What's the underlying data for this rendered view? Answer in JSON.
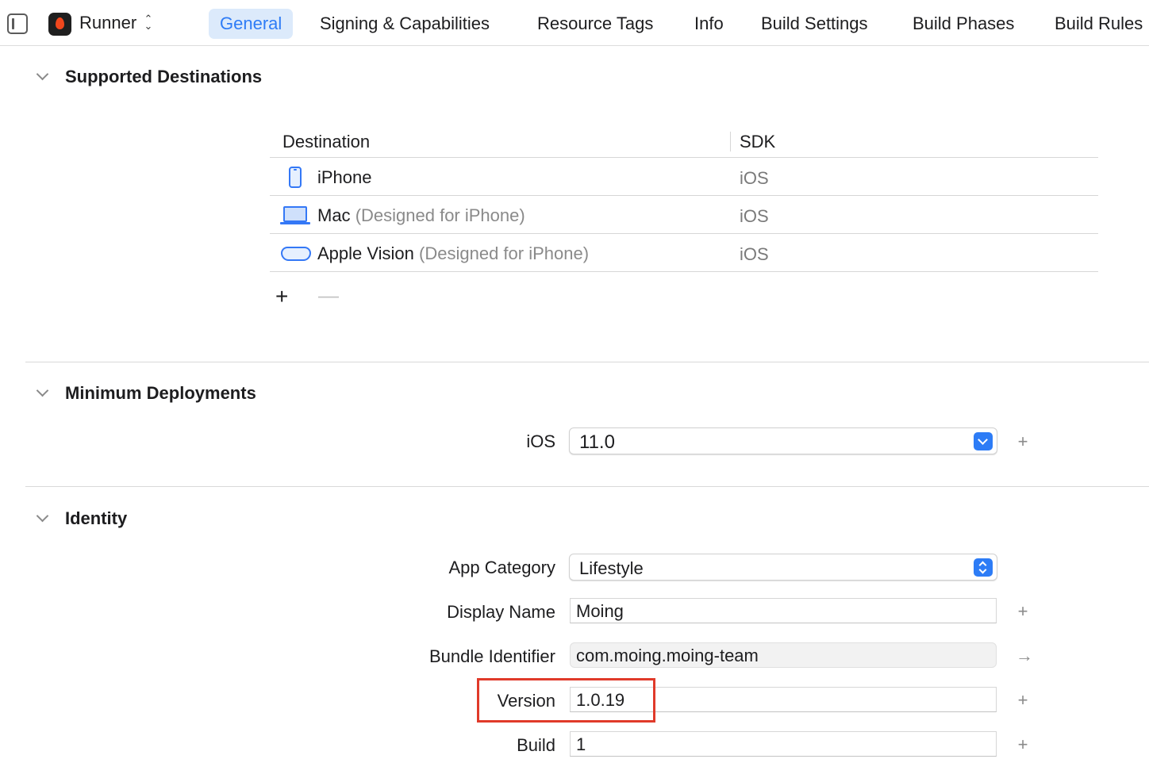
{
  "toolbar": {
    "scheme_name": "Runner",
    "scheme_chevron": "⌃⌄",
    "tabs": [
      {
        "label": "General",
        "active": true
      },
      {
        "label": "Signing & Capabilities"
      },
      {
        "label": "Resource Tags"
      },
      {
        "label": "Info"
      },
      {
        "label": "Build Settings"
      },
      {
        "label": "Build Phases"
      },
      {
        "label": "Build Rules"
      }
    ]
  },
  "supported_destinations": {
    "title": "Supported Destinations",
    "columns": {
      "destination": "Destination",
      "sdk": "SDK"
    },
    "rows": [
      {
        "icon": "iphone-icon",
        "name": "iPhone",
        "note": "",
        "sdk": "iOS"
      },
      {
        "icon": "mac-icon",
        "name": "Mac",
        "note": "(Designed for iPhone)",
        "sdk": "iOS"
      },
      {
        "icon": "vision-pro-icon",
        "name": "Apple Vision",
        "note": "(Designed for iPhone)",
        "sdk": "iOS"
      }
    ],
    "add_label": "+",
    "remove_label": "—"
  },
  "minimum_deployments": {
    "title": "Minimum Deployments",
    "ios_label": "iOS",
    "ios_value": "11.0",
    "add_label": "+"
  },
  "identity": {
    "title": "Identity",
    "app_category_label": "App Category",
    "app_category_value": "Lifestyle",
    "display_name_label": "Display Name",
    "display_name_value": "Moing",
    "bundle_identifier_label": "Bundle Identifier",
    "bundle_identifier_value": "com.moing.moing-team",
    "version_label": "Version",
    "version_value": "1.0.19",
    "build_label": "Build",
    "build_value": "1",
    "add_label": "+",
    "arrow_label": "→"
  },
  "colors": {
    "accent": "#2e7cf6",
    "active_tab_bg": "#dceafb",
    "highlight_border": "#e03a2a"
  }
}
